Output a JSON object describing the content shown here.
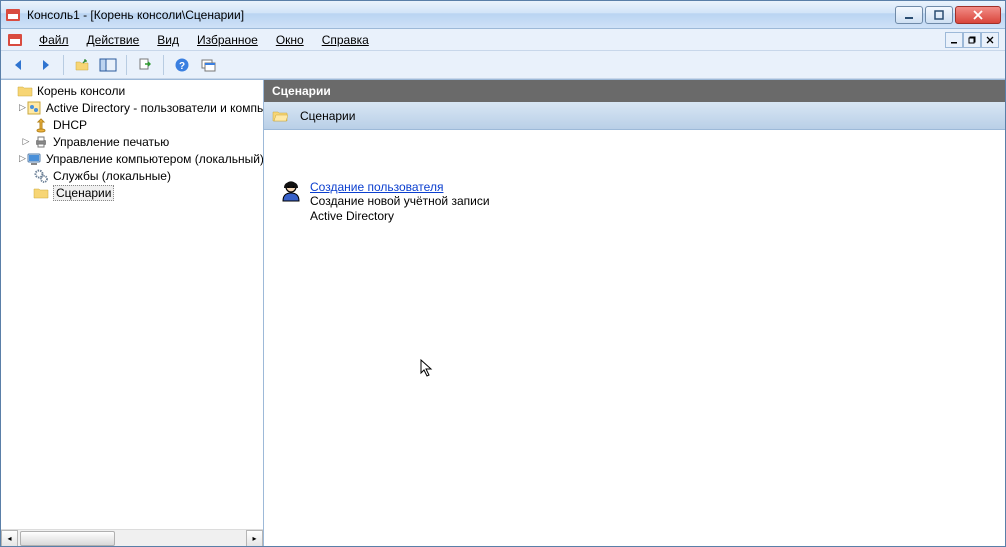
{
  "window": {
    "title": "Консоль1 - [Корень консоли\\Сценарии]"
  },
  "menu": {
    "file": "Файл",
    "action": "Действие",
    "view": "Вид",
    "favorites": "Избранное",
    "window": "Окно",
    "help": "Справка"
  },
  "tree": {
    "root": "Корень консоли",
    "items": [
      {
        "label": "Active Directory - пользователи и компьютеры"
      },
      {
        "label": "DHCP"
      },
      {
        "label": "Управление печатью"
      },
      {
        "label": "Управление компьютером (локальный)"
      },
      {
        "label": "Службы (локальные)"
      },
      {
        "label": "Сценарии"
      }
    ]
  },
  "main": {
    "header": "Сценарии",
    "subheader": "Сценарии",
    "action": {
      "link": "Создание пользователя",
      "desc1": "Создание новой учётной записи",
      "desc2": "Active Directory"
    }
  }
}
